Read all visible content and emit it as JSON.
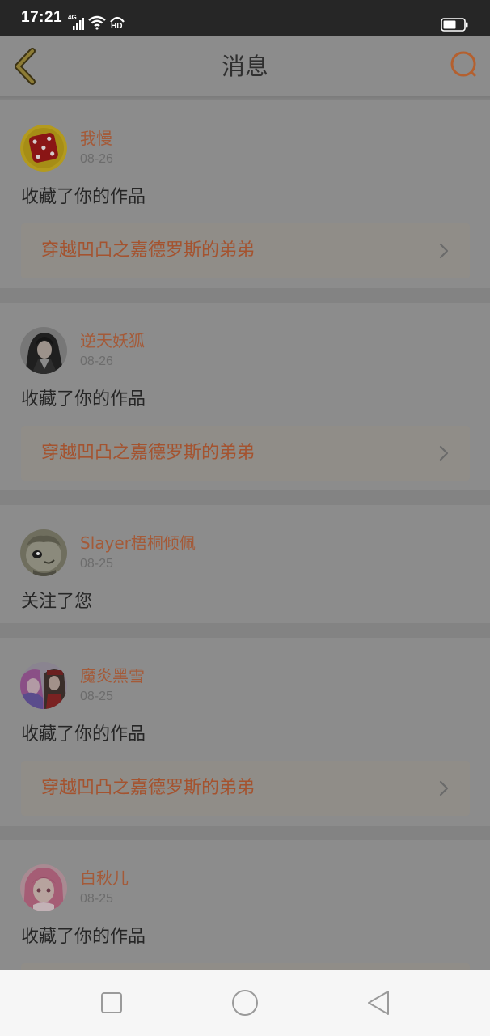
{
  "status_bar": {
    "time": "17:21",
    "network": "4G",
    "hd": "HD",
    "icons": [
      "signal-icon",
      "wifi-icon",
      "hd-icon",
      "battery-icon"
    ]
  },
  "header": {
    "title": "消息",
    "back_icon": "chevron-left-icon",
    "search_icon": "search-icon"
  },
  "messages": [
    {
      "name": "我慢",
      "date": "08-26",
      "action": "收藏了你的作品",
      "work_title": "穿越凹凸之嘉德罗斯的弟弟",
      "avatar": "red-dice-avatar"
    },
    {
      "name": "逆天妖狐",
      "date": "08-26",
      "action": "收藏了你的作品",
      "work_title": "穿越凹凸之嘉德罗斯的弟弟",
      "avatar": "dark-haired-character-avatar"
    },
    {
      "name": "Slayer梧桐倾佩",
      "date": "08-25",
      "action": "关注了您",
      "avatar": "creature-avatar"
    },
    {
      "name": "魔炎黑雪",
      "date": "08-25",
      "action": "收藏了你的作品",
      "work_title": "穿越凹凸之嘉德罗斯的弟弟",
      "avatar": "colorful-characters-avatar"
    },
    {
      "name": "白秋儿",
      "date": "08-25",
      "action": "收藏了你的作品",
      "avatar": "pink-haired-character-avatar"
    }
  ],
  "nav_bar": {
    "icons": [
      "recent-apps-icon",
      "home-icon",
      "back-triangle-icon"
    ]
  },
  "colors": {
    "accent": "#a45a38",
    "accent_link": "#a4532f",
    "card_bg": "#8c8c8c"
  }
}
